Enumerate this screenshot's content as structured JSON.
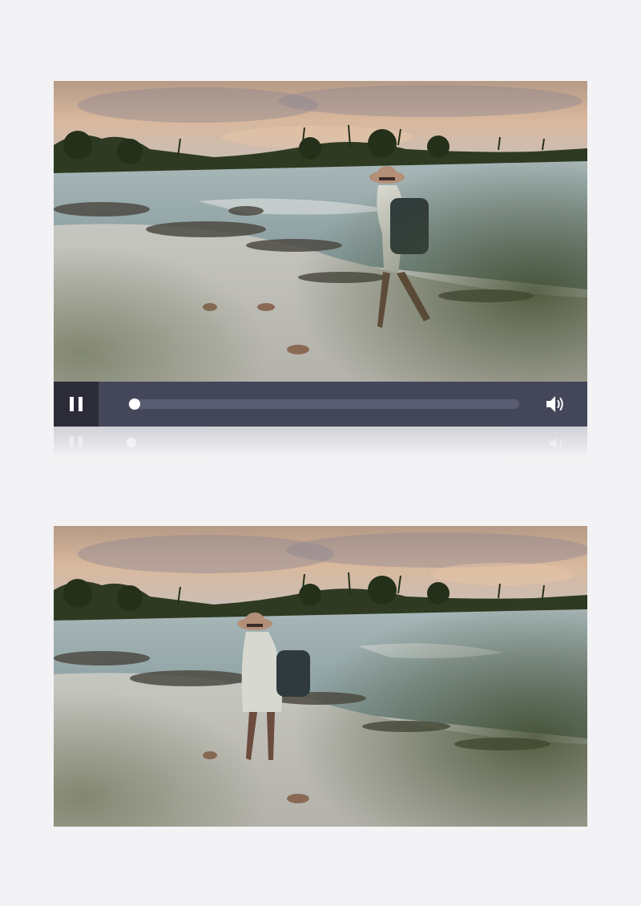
{
  "player": {
    "state": "playing",
    "progress_fraction": 0,
    "accent_color": "#44465a",
    "controls": {
      "play_toggle_icon": "pause-icon",
      "volume_icon": "volume-icon"
    }
  },
  "colors": {
    "page_background": "#f3f3f5",
    "control_bar": "#44465a",
    "play_button_background": "#2b2c38",
    "track": "#5a5c71"
  }
}
